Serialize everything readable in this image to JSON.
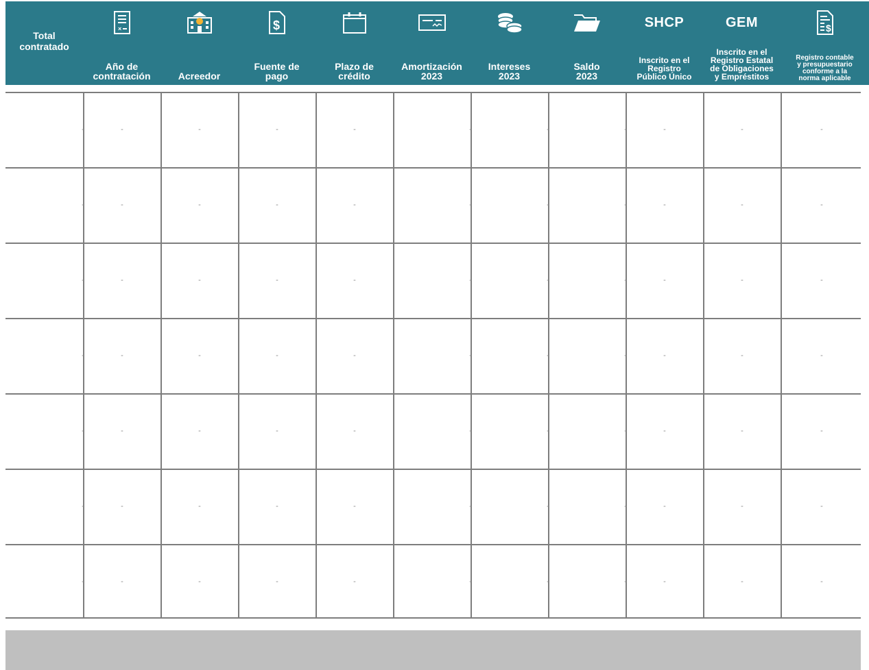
{
  "header": {
    "background_color": "#2b7a8a",
    "columns": [
      {
        "label": "Total\ncontratado",
        "icon": null
      },
      {
        "label": "Año de\ncontratación",
        "icon": "checklist-document-icon"
      },
      {
        "label": "Acreedor",
        "icon": "bank-building-icon"
      },
      {
        "label": "Fuente de\npago",
        "icon": "dollar-document-icon"
      },
      {
        "label": "Plazo de\ncrédito",
        "icon": "calendar-icon"
      },
      {
        "label": "Amortización\n2023",
        "icon": "bank-check-icon"
      },
      {
        "label": "Intereses\n2023",
        "icon": "coins-stack-icon"
      },
      {
        "label": "Saldo\n2023",
        "icon": "open-folder-icon"
      },
      {
        "label": "Inscrito en el\nRegistro\nPúblico Único",
        "heading": "SHCP"
      },
      {
        "label": "Inscrito en el\nRegistro Estatal\nde Obligaciones\ny Empréstitos",
        "heading": "GEM"
      },
      {
        "label": "Registro contable\ny presupuestario\nconforme a la\nnorma aplicable",
        "icon": "dollar-ledger-icon"
      }
    ]
  },
  "rows": [
    [
      "-",
      "-",
      "-",
      "-",
      "-",
      "-",
      "-",
      "-",
      "-",
      "-",
      "-"
    ],
    [
      "-",
      "-",
      "-",
      "-",
      "-",
      "-",
      "-",
      "-",
      "-",
      "-",
      "-"
    ],
    [
      "-",
      "-",
      "-",
      "-",
      "-",
      "-",
      "-",
      "-",
      "-",
      "-",
      "-"
    ],
    [
      "-",
      "-",
      "-",
      "-",
      "-",
      "-",
      "-",
      "-",
      "-",
      "-",
      "-"
    ],
    [
      "-",
      "-",
      "-",
      "-",
      "-",
      "-",
      "-",
      "-",
      "-",
      "-",
      "-"
    ],
    [
      "-",
      "-",
      "-",
      "-",
      "-",
      "-",
      "-",
      "-",
      "-",
      "-",
      "-"
    ],
    [
      "-",
      "-",
      "-",
      "-",
      "-",
      "-",
      "-",
      "-",
      "-",
      "-",
      "-"
    ]
  ],
  "colors": {
    "grid_line": "#7d7d7d",
    "footer_band": "#bfbfbf",
    "cell_text": "#8a8a8a"
  }
}
